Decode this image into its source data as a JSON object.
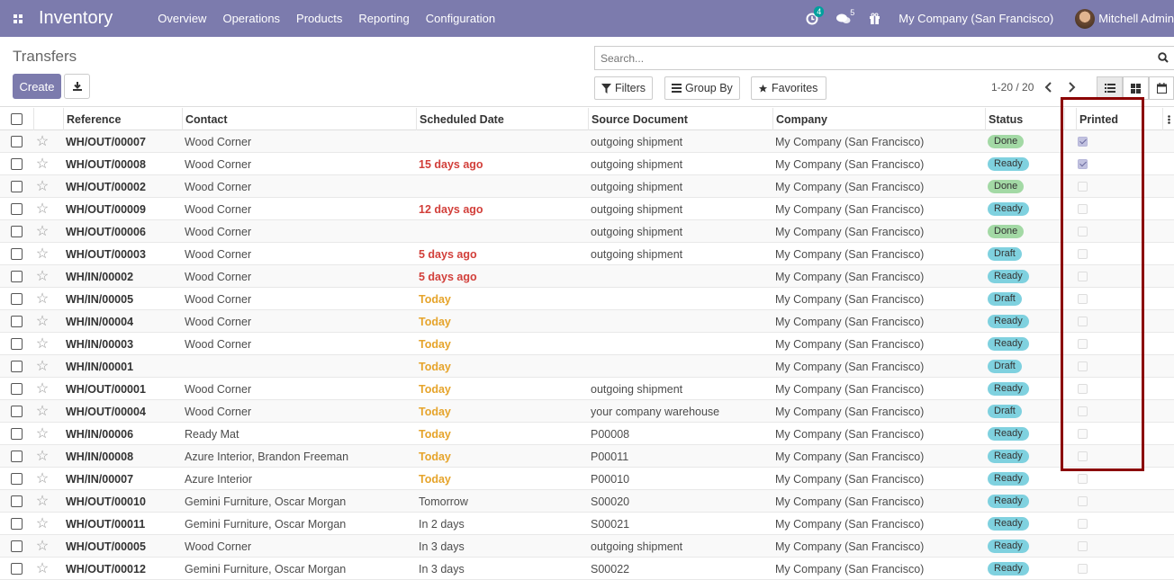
{
  "navbar": {
    "app_name": "Inventory",
    "menu": [
      "Overview",
      "Operations",
      "Products",
      "Reporting",
      "Configuration"
    ],
    "activity_count": "4",
    "message_count": "5",
    "company": "My Company (San Francisco)",
    "user": "Mitchell Admin",
    "bg_color": "#7c7bad"
  },
  "control": {
    "title": "Transfers",
    "create_label": "Create",
    "search_placeholder": "Search...",
    "filters_label": "Filters",
    "groupby_label": "Group By",
    "favorites_label": "Favorites",
    "pager": "1-20 / 20"
  },
  "table": {
    "headers": {
      "reference": "Reference",
      "contact": "Contact",
      "scheduled": "Scheduled Date",
      "source": "Source Document",
      "company": "Company",
      "status": "Status",
      "printed": "Printed"
    },
    "rows": [
      {
        "ref": "WH/OUT/00007",
        "contact": "Wood Corner",
        "date": "",
        "date_type": "",
        "source": "outgoing shipment",
        "company": "My Company (San Francisco)",
        "status": "Done",
        "printed": true
      },
      {
        "ref": "WH/OUT/00008",
        "contact": "Wood Corner",
        "date": "15 days ago",
        "date_type": "late",
        "source": "outgoing shipment",
        "company": "My Company (San Francisco)",
        "status": "Ready",
        "printed": true
      },
      {
        "ref": "WH/OUT/00002",
        "contact": "Wood Corner",
        "date": "",
        "date_type": "",
        "source": "outgoing shipment",
        "company": "My Company (San Francisco)",
        "status": "Done",
        "printed": false
      },
      {
        "ref": "WH/OUT/00009",
        "contact": "Wood Corner",
        "date": "12 days ago",
        "date_type": "late",
        "source": "outgoing shipment",
        "company": "My Company (San Francisco)",
        "status": "Ready",
        "printed": false
      },
      {
        "ref": "WH/OUT/00006",
        "contact": "Wood Corner",
        "date": "",
        "date_type": "",
        "source": "outgoing shipment",
        "company": "My Company (San Francisco)",
        "status": "Done",
        "printed": false
      },
      {
        "ref": "WH/OUT/00003",
        "contact": "Wood Corner",
        "date": "5 days ago",
        "date_type": "late",
        "source": "outgoing shipment",
        "company": "My Company (San Francisco)",
        "status": "Draft",
        "printed": false
      },
      {
        "ref": "WH/IN/00002",
        "contact": "Wood Corner",
        "date": "5 days ago",
        "date_type": "late",
        "source": "",
        "company": "My Company (San Francisco)",
        "status": "Ready",
        "printed": false
      },
      {
        "ref": "WH/IN/00005",
        "contact": "Wood Corner",
        "date": "Today",
        "date_type": "today",
        "source": "",
        "company": "My Company (San Francisco)",
        "status": "Draft",
        "printed": false
      },
      {
        "ref": "WH/IN/00004",
        "contact": "Wood Corner",
        "date": "Today",
        "date_type": "today",
        "source": "",
        "company": "My Company (San Francisco)",
        "status": "Ready",
        "printed": false
      },
      {
        "ref": "WH/IN/00003",
        "contact": "Wood Corner",
        "date": "Today",
        "date_type": "today",
        "source": "",
        "company": "My Company (San Francisco)",
        "status": "Ready",
        "printed": false
      },
      {
        "ref": "WH/IN/00001",
        "contact": "",
        "date": "Today",
        "date_type": "today",
        "source": "",
        "company": "My Company (San Francisco)",
        "status": "Draft",
        "printed": false
      },
      {
        "ref": "WH/OUT/00001",
        "contact": "Wood Corner",
        "date": "Today",
        "date_type": "today",
        "source": "outgoing shipment",
        "company": "My Company (San Francisco)",
        "status": "Ready",
        "printed": false
      },
      {
        "ref": "WH/OUT/00004",
        "contact": "Wood Corner",
        "date": "Today",
        "date_type": "today",
        "source": "your company warehouse",
        "company": "My Company (San Francisco)",
        "status": "Draft",
        "printed": false
      },
      {
        "ref": "WH/IN/00006",
        "contact": "Ready Mat",
        "date": "Today",
        "date_type": "today",
        "source": "P00008",
        "company": "My Company (San Francisco)",
        "status": "Ready",
        "printed": false
      },
      {
        "ref": "WH/IN/00008",
        "contact": "Azure Interior, Brandon Freeman",
        "date": "Today",
        "date_type": "today",
        "source": "P00011",
        "company": "My Company (San Francisco)",
        "status": "Ready",
        "printed": false
      },
      {
        "ref": "WH/IN/00007",
        "contact": "Azure Interior",
        "date": "Today",
        "date_type": "today",
        "source": "P00010",
        "company": "My Company (San Francisco)",
        "status": "Ready",
        "printed": false
      },
      {
        "ref": "WH/OUT/00010",
        "contact": "Gemini Furniture, Oscar Morgan",
        "date": "Tomorrow",
        "date_type": "",
        "source": "S00020",
        "company": "My Company (San Francisco)",
        "status": "Ready",
        "printed": false
      },
      {
        "ref": "WH/OUT/00011",
        "contact": "Gemini Furniture, Oscar Morgan",
        "date": "In 2 days",
        "date_type": "",
        "source": "S00021",
        "company": "My Company (San Francisco)",
        "status": "Ready",
        "printed": false
      },
      {
        "ref": "WH/OUT/00005",
        "contact": "Wood Corner",
        "date": "In 3 days",
        "date_type": "",
        "source": "outgoing shipment",
        "company": "My Company (San Francisco)",
        "status": "Ready",
        "printed": false
      },
      {
        "ref": "WH/OUT/00012",
        "contact": "Gemini Furniture, Oscar Morgan",
        "date": "In 3 days",
        "date_type": "",
        "source": "S00022",
        "company": "My Company (San Francisco)",
        "status": "Ready",
        "printed": false
      }
    ]
  }
}
